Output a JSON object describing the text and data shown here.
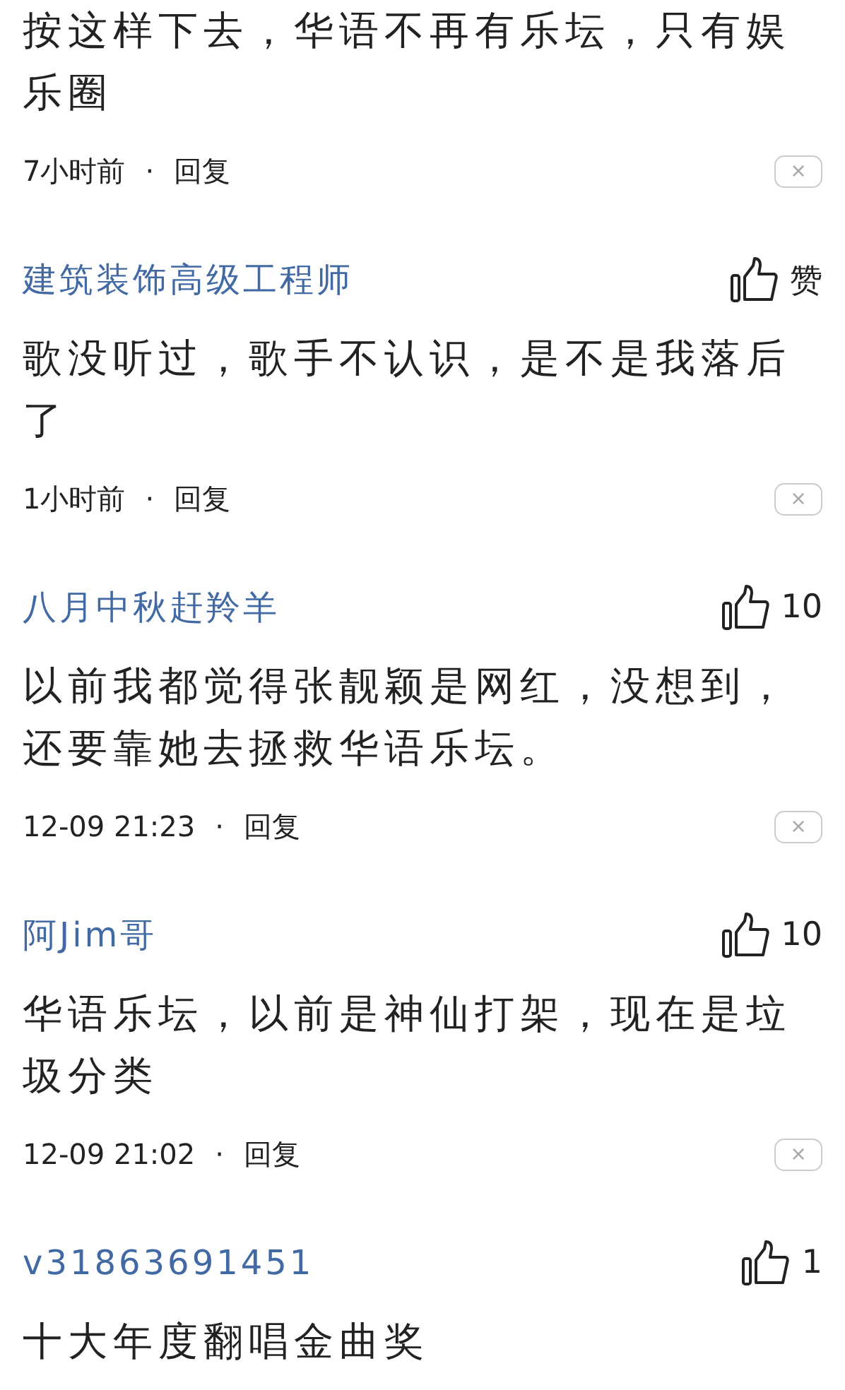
{
  "separator": "·",
  "comments": [
    {
      "text": "按这样下去，华语不再有乐坛，只有娱乐圈",
      "time": "7小时前",
      "reply": "回复",
      "close": "×"
    },
    {
      "author": "建筑装饰高级工程师",
      "likes": "赞",
      "text": "歌没听过，歌手不认识，是不是我落后了",
      "time": "1小时前",
      "reply": "回复",
      "close": "×"
    },
    {
      "author": "八月中秋赶羚羊",
      "likes": "10",
      "text": "以前我都觉得张靓颖是网红，没想到，还要靠她去拯救华语乐坛。",
      "time": "12-09 21:23",
      "reply": "回复",
      "close": "×"
    },
    {
      "author": "阿Jim哥",
      "likes": "10",
      "text": "华语乐坛，以前是神仙打架，现在是垃圾分类",
      "time": "12-09 21:02",
      "reply": "回复",
      "close": "×"
    },
    {
      "author": "v31863691451",
      "likes": "1",
      "text": "十大年度翻唱金曲奖"
    }
  ]
}
